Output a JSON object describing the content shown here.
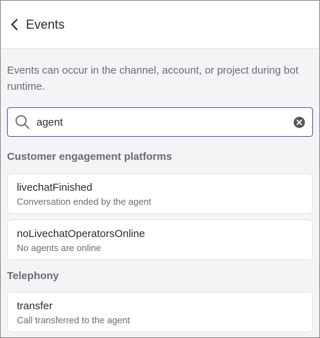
{
  "header": {
    "title": "Events",
    "back_icon": "chevron-left-icon"
  },
  "description": "Events can occur in the channel, account, or project during bot runtime.",
  "search": {
    "value": "agent",
    "icon": "search-icon",
    "clear_icon": "clear-circle-icon"
  },
  "sections": [
    {
      "title": "Customer engagement platforms",
      "events": [
        {
          "name": "livechatFinished",
          "description": "Conversation ended by the agent"
        },
        {
          "name": "noLivechatOperatorsOnline",
          "description": "No agents are online"
        }
      ]
    },
    {
      "title": "Telephony",
      "events": [
        {
          "name": "transfer",
          "description": "Call transferred to the agent"
        }
      ]
    }
  ],
  "colors": {
    "accent": "#5b4fb3",
    "text": "#2b2b30",
    "muted": "#6b6b73",
    "background": "#f4f4f6"
  }
}
